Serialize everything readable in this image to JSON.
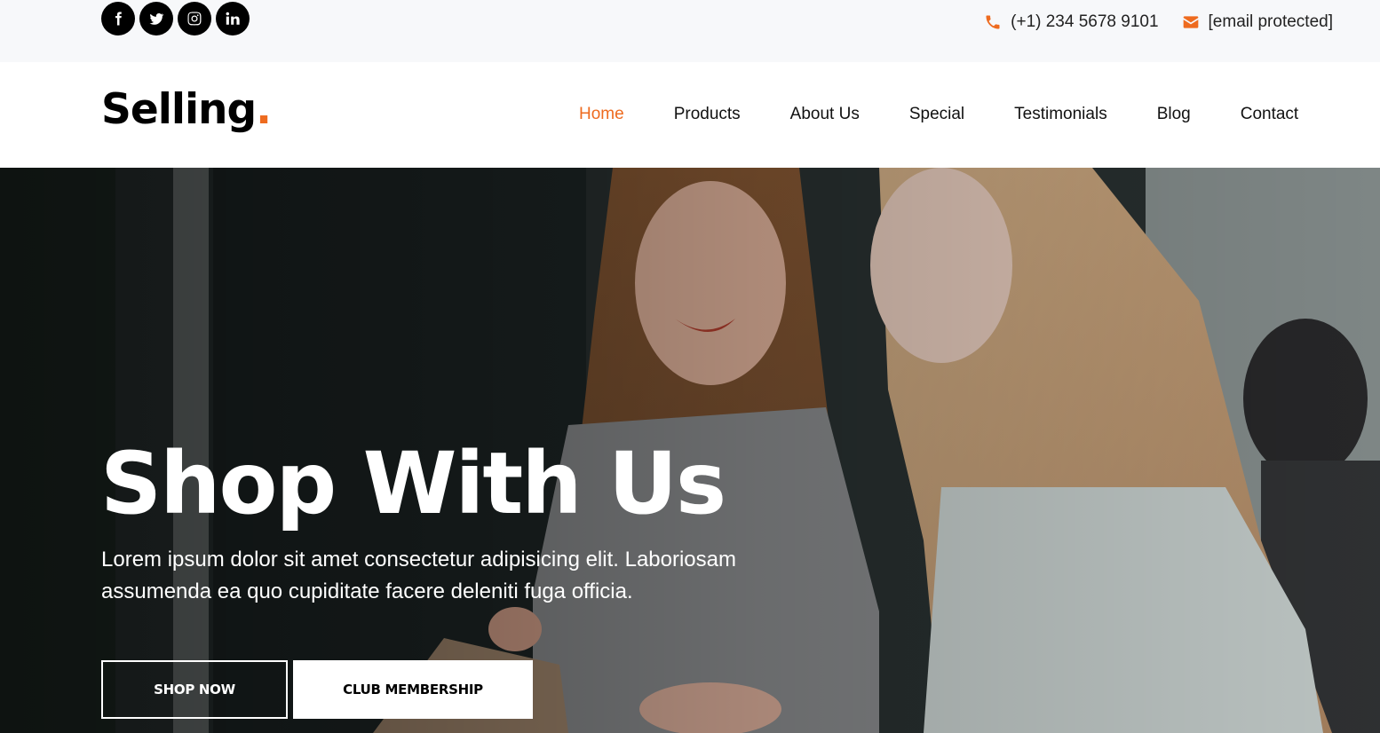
{
  "topbar": {
    "social": [
      {
        "name": "facebook-icon"
      },
      {
        "name": "twitter-icon"
      },
      {
        "name": "instagram-icon"
      },
      {
        "name": "linkedin-icon"
      }
    ],
    "phone": "(+1) 234 5678 9101",
    "email": "[email protected]",
    "accent_color": "#ee6b1f"
  },
  "header": {
    "logo_text": "Selling",
    "logo_dot": ".",
    "nav": [
      "Home",
      "Products",
      "About Us",
      "Special",
      "Testimonials",
      "Blog",
      "Contact"
    ],
    "active_nav": "Home"
  },
  "hero": {
    "title": "Shop With Us",
    "text": "Lorem ipsum dolor sit amet consectetur adipisicing elit. Laboriosam assumenda ea quo cupiditate facere deleniti fuga officia.",
    "shop_button": "SHOP NOW",
    "club_button": "CLUB MEMBERSHIP"
  }
}
